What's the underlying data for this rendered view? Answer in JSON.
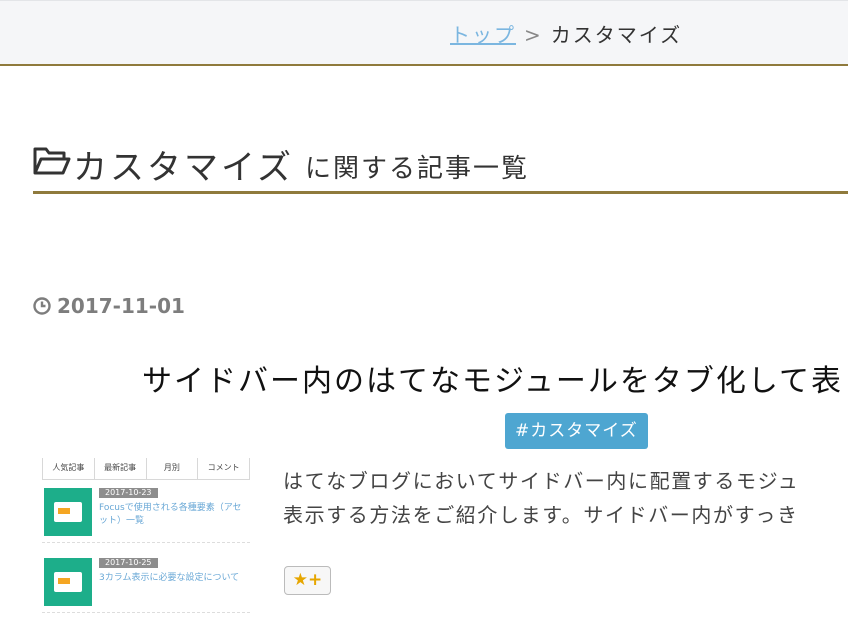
{
  "breadcrumb": {
    "home": "トップ",
    "separator": ">",
    "current": "カスタマイズ"
  },
  "archive": {
    "category": "カスタマイズ",
    "suffix": "に関する記事一覧"
  },
  "post": {
    "date": "2017-11-01",
    "title": "サイドバー内のはてなモジュールをタブ化して表",
    "tag": "#カスタマイズ",
    "excerpt": [
      "はてなブログにおいてサイドバー内に配置するモジュ",
      "表示する方法をご紹介します。サイドバー内がすっき"
    ],
    "star_icon": "★",
    "star_plus": "+"
  },
  "thumbnail": {
    "tabs": [
      "人気記事",
      "最新記事",
      "月別",
      "コメント"
    ],
    "items": [
      {
        "date": "2017-10-23",
        "title": "Focusで使用される各種要素（アセット）一覧"
      },
      {
        "date": "2017-10-25",
        "title": "3カラム表示に必要な設定について"
      }
    ]
  },
  "colors": {
    "accent": "#8f7a3c",
    "link": "#7bb6e0",
    "tag_bg": "#4ea6d1"
  }
}
